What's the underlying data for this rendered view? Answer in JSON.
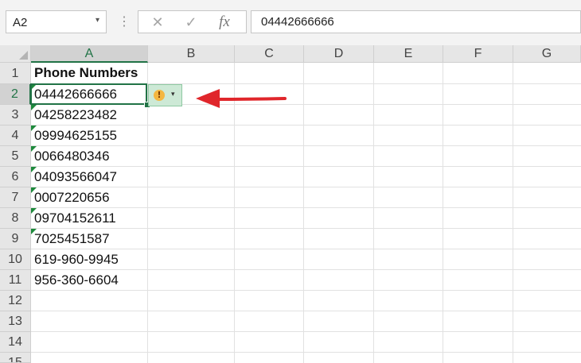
{
  "namebox": {
    "value": "A2",
    "caret": "▾"
  },
  "formula_bar": {
    "dots": "⋮",
    "cancel_icon": "✕",
    "enter_icon": "✓",
    "fx_label": "fx",
    "content": "04442666666"
  },
  "columns": [
    "A",
    "B",
    "C",
    "D",
    "E",
    "F",
    "G"
  ],
  "rows": [
    "1",
    "2",
    "3",
    "4",
    "5",
    "6",
    "7",
    "8",
    "9",
    "10",
    "11",
    "12",
    "13",
    "14",
    "15"
  ],
  "cells": {
    "A1": "Phone Numbers",
    "A": [
      {
        "value": "04442666666",
        "text_flag": true
      },
      {
        "value": "04258223482",
        "text_flag": true
      },
      {
        "value": "09994625155",
        "text_flag": true
      },
      {
        "value": "0066480346",
        "text_flag": true
      },
      {
        "value": "04093566047",
        "text_flag": true
      },
      {
        "value": "0007220656",
        "text_flag": true
      },
      {
        "value": "09704152611",
        "text_flag": true
      },
      {
        "value": "7025451587",
        "text_flag": true
      },
      {
        "value": "619-960-9945",
        "text_flag": false
      },
      {
        "value": "956-360-6604",
        "text_flag": false
      }
    ]
  },
  "selected_cell": "A2",
  "error_button": {
    "icon": "!",
    "dropdown": "▾"
  },
  "colors": {
    "accent": "#217346",
    "flag": "#1e8a3c",
    "arrow": "#e0262b",
    "error_bg": "#cde9d6"
  }
}
